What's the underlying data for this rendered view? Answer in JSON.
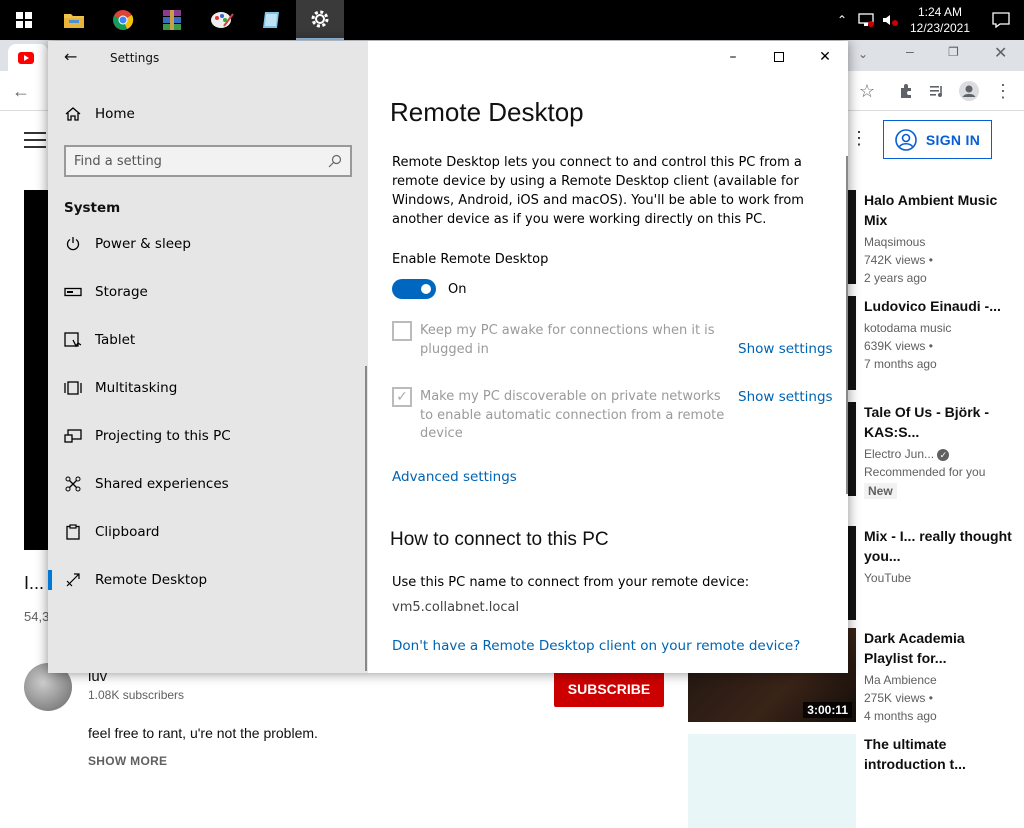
{
  "taskbar": {
    "time": "1:24 AM",
    "date": "12/23/2021",
    "icons": [
      "windows-start-icon",
      "file-explorer-icon",
      "chrome-icon",
      "winrar-icon",
      "paint-icon",
      "notepad-icon",
      "settings-gear-icon"
    ]
  },
  "browser": {
    "sign_in": "SIGN IN",
    "left_video": {
      "title": "I...",
      "views": "54,3",
      "channel": "luv",
      "subscribers": "1.08K subscribers",
      "subscribe": "SUBSCRIBE",
      "description": "feel free to rant, u're not the problem.",
      "show_more": "SHOW MORE"
    },
    "recommendations": [
      {
        "title": "Halo Ambient Music Mix",
        "channel": "Maqsimous",
        "views": "742K views •",
        "age": "2 years ago"
      },
      {
        "title": "Ludovico Einaudi -...",
        "channel": "kotodama music",
        "views": "639K views •",
        "age": "7 months ago"
      },
      {
        "title": "Tale Of Us - Björk - KAS:S...",
        "channel": "Electro Jun...",
        "views": "Recommended for you",
        "age": "",
        "badge": "New"
      },
      {
        "title": "Mix - I... really thought you...",
        "channel": "YouTube",
        "views": "",
        "age": ""
      },
      {
        "title": "Dark Academia Playlist for...",
        "channel": "Ma Ambience",
        "views": "275K views •",
        "age": "4 months ago",
        "duration": "3:00:11"
      },
      {
        "title": "The ultimate introduction t...",
        "channel": "",
        "views": "",
        "age": ""
      }
    ]
  },
  "settings": {
    "window_title": "Settings",
    "home_label": "Home",
    "search_placeholder": "Find a setting",
    "section": "System",
    "nav": [
      {
        "label": "Power & sleep",
        "icon": "power-icon"
      },
      {
        "label": "Storage",
        "icon": "storage-icon"
      },
      {
        "label": "Tablet",
        "icon": "tablet-icon"
      },
      {
        "label": "Multitasking",
        "icon": "multitasking-icon"
      },
      {
        "label": "Projecting to this PC",
        "icon": "projecting-icon"
      },
      {
        "label": "Shared experiences",
        "icon": "shared-experiences-icon"
      },
      {
        "label": "Clipboard",
        "icon": "clipboard-icon"
      },
      {
        "label": "Remote Desktop",
        "icon": "remote-desktop-icon",
        "selected": true
      }
    ],
    "main": {
      "title": "Remote Desktop",
      "intro": "Remote Desktop lets you connect to and control this PC from a remote device by using a Remote Desktop client (available for Windows, Android, iOS and macOS). You'll be able to work from another device as if you were working directly on this PC.",
      "enable_label": "Enable Remote Desktop",
      "toggle_state": "On",
      "keep_awake": "Keep my PC awake for connections when it is plugged in",
      "discoverable": "Make my PC discoverable on private networks to enable automatic connection from a remote device",
      "show_settings": "Show settings",
      "advanced": "Advanced settings",
      "how_heading": "How to connect to this PC",
      "use_name": "Use this PC name to connect from your remote device:",
      "pc_name": "vm5.collabnet.local",
      "client_link": "Don't have a Remote Desktop client on your remote device?"
    }
  }
}
